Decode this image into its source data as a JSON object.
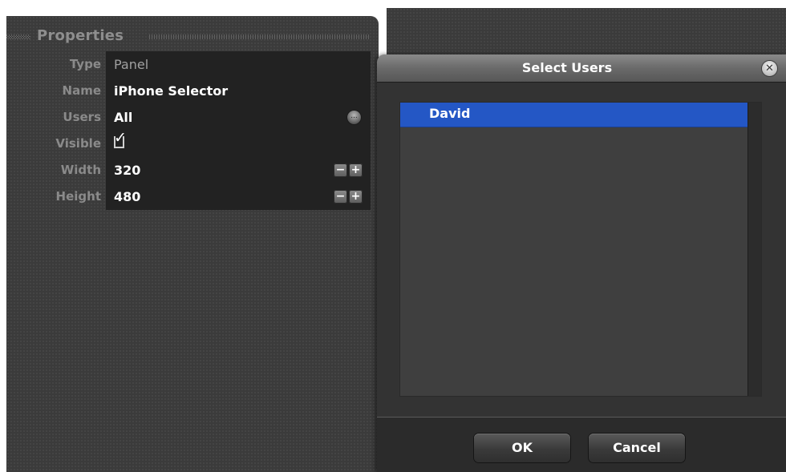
{
  "properties": {
    "title": "Properties",
    "rows": [
      {
        "label": "Type",
        "value": "Panel"
      },
      {
        "label": "Name",
        "value": "iPhone Selector"
      },
      {
        "label": "Users",
        "value": "All"
      },
      {
        "label": "Visible",
        "value": "checked"
      },
      {
        "label": "Width",
        "value": "320"
      },
      {
        "label": "Height",
        "value": "480"
      }
    ],
    "ellipsis_glyph": "...",
    "checkbox_glyph": "✓",
    "stepper_minus": "−",
    "stepper_plus": "+"
  },
  "dialog": {
    "title": "Select Users",
    "close_glyph": "✕",
    "users": [
      "David"
    ],
    "selected_user": "David",
    "ok_label": "OK",
    "cancel_label": "Cancel"
  },
  "colors": {
    "selection": "#2457c5",
    "background": "#3b3b3b",
    "value_cell": "#222222"
  }
}
